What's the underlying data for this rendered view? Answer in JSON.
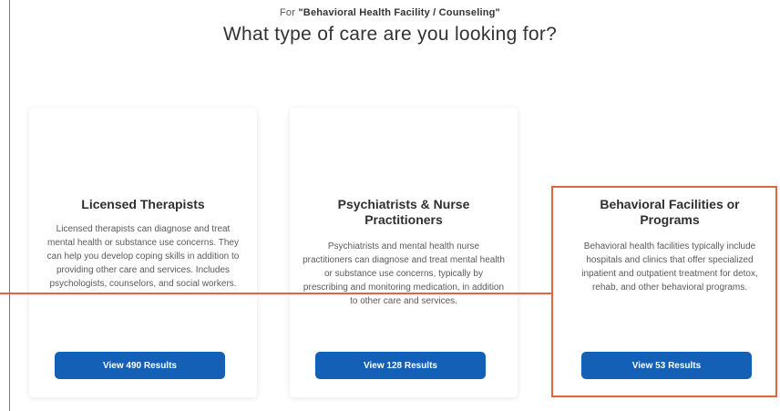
{
  "header": {
    "for_prefix": "For",
    "for_value": "\"Behavioral Health Facility / Counseling\"",
    "question": "What type of care are you looking for?"
  },
  "cards": [
    {
      "title": "Licensed Therapists",
      "description": "Licensed therapists can diagnose and treat mental health or substance use concerns. They can help you develop coping skills in addition to providing other care and services. Includes psychologists, counselors, and social workers.",
      "button": "View 490 Results"
    },
    {
      "title": "Psychiatrists & Nurse Practitioners",
      "description": "Psychiatrists and mental health nurse practitioners can diagnose and treat mental health or substance use concerns, typically by prescribing and monitoring medication, in addition to other care and services.",
      "button": "View 128 Results"
    },
    {
      "title": "Behavioral Facilities or Programs",
      "description": "Behavioral health facilities typically include hospitals and clinics that offer specialized inpatient and outpatient treatment for detox, rehab, and other behavioral programs.",
      "button": "View 53 Results"
    }
  ],
  "colors": {
    "button": "#1560b7",
    "highlight": "#e0673c"
  }
}
